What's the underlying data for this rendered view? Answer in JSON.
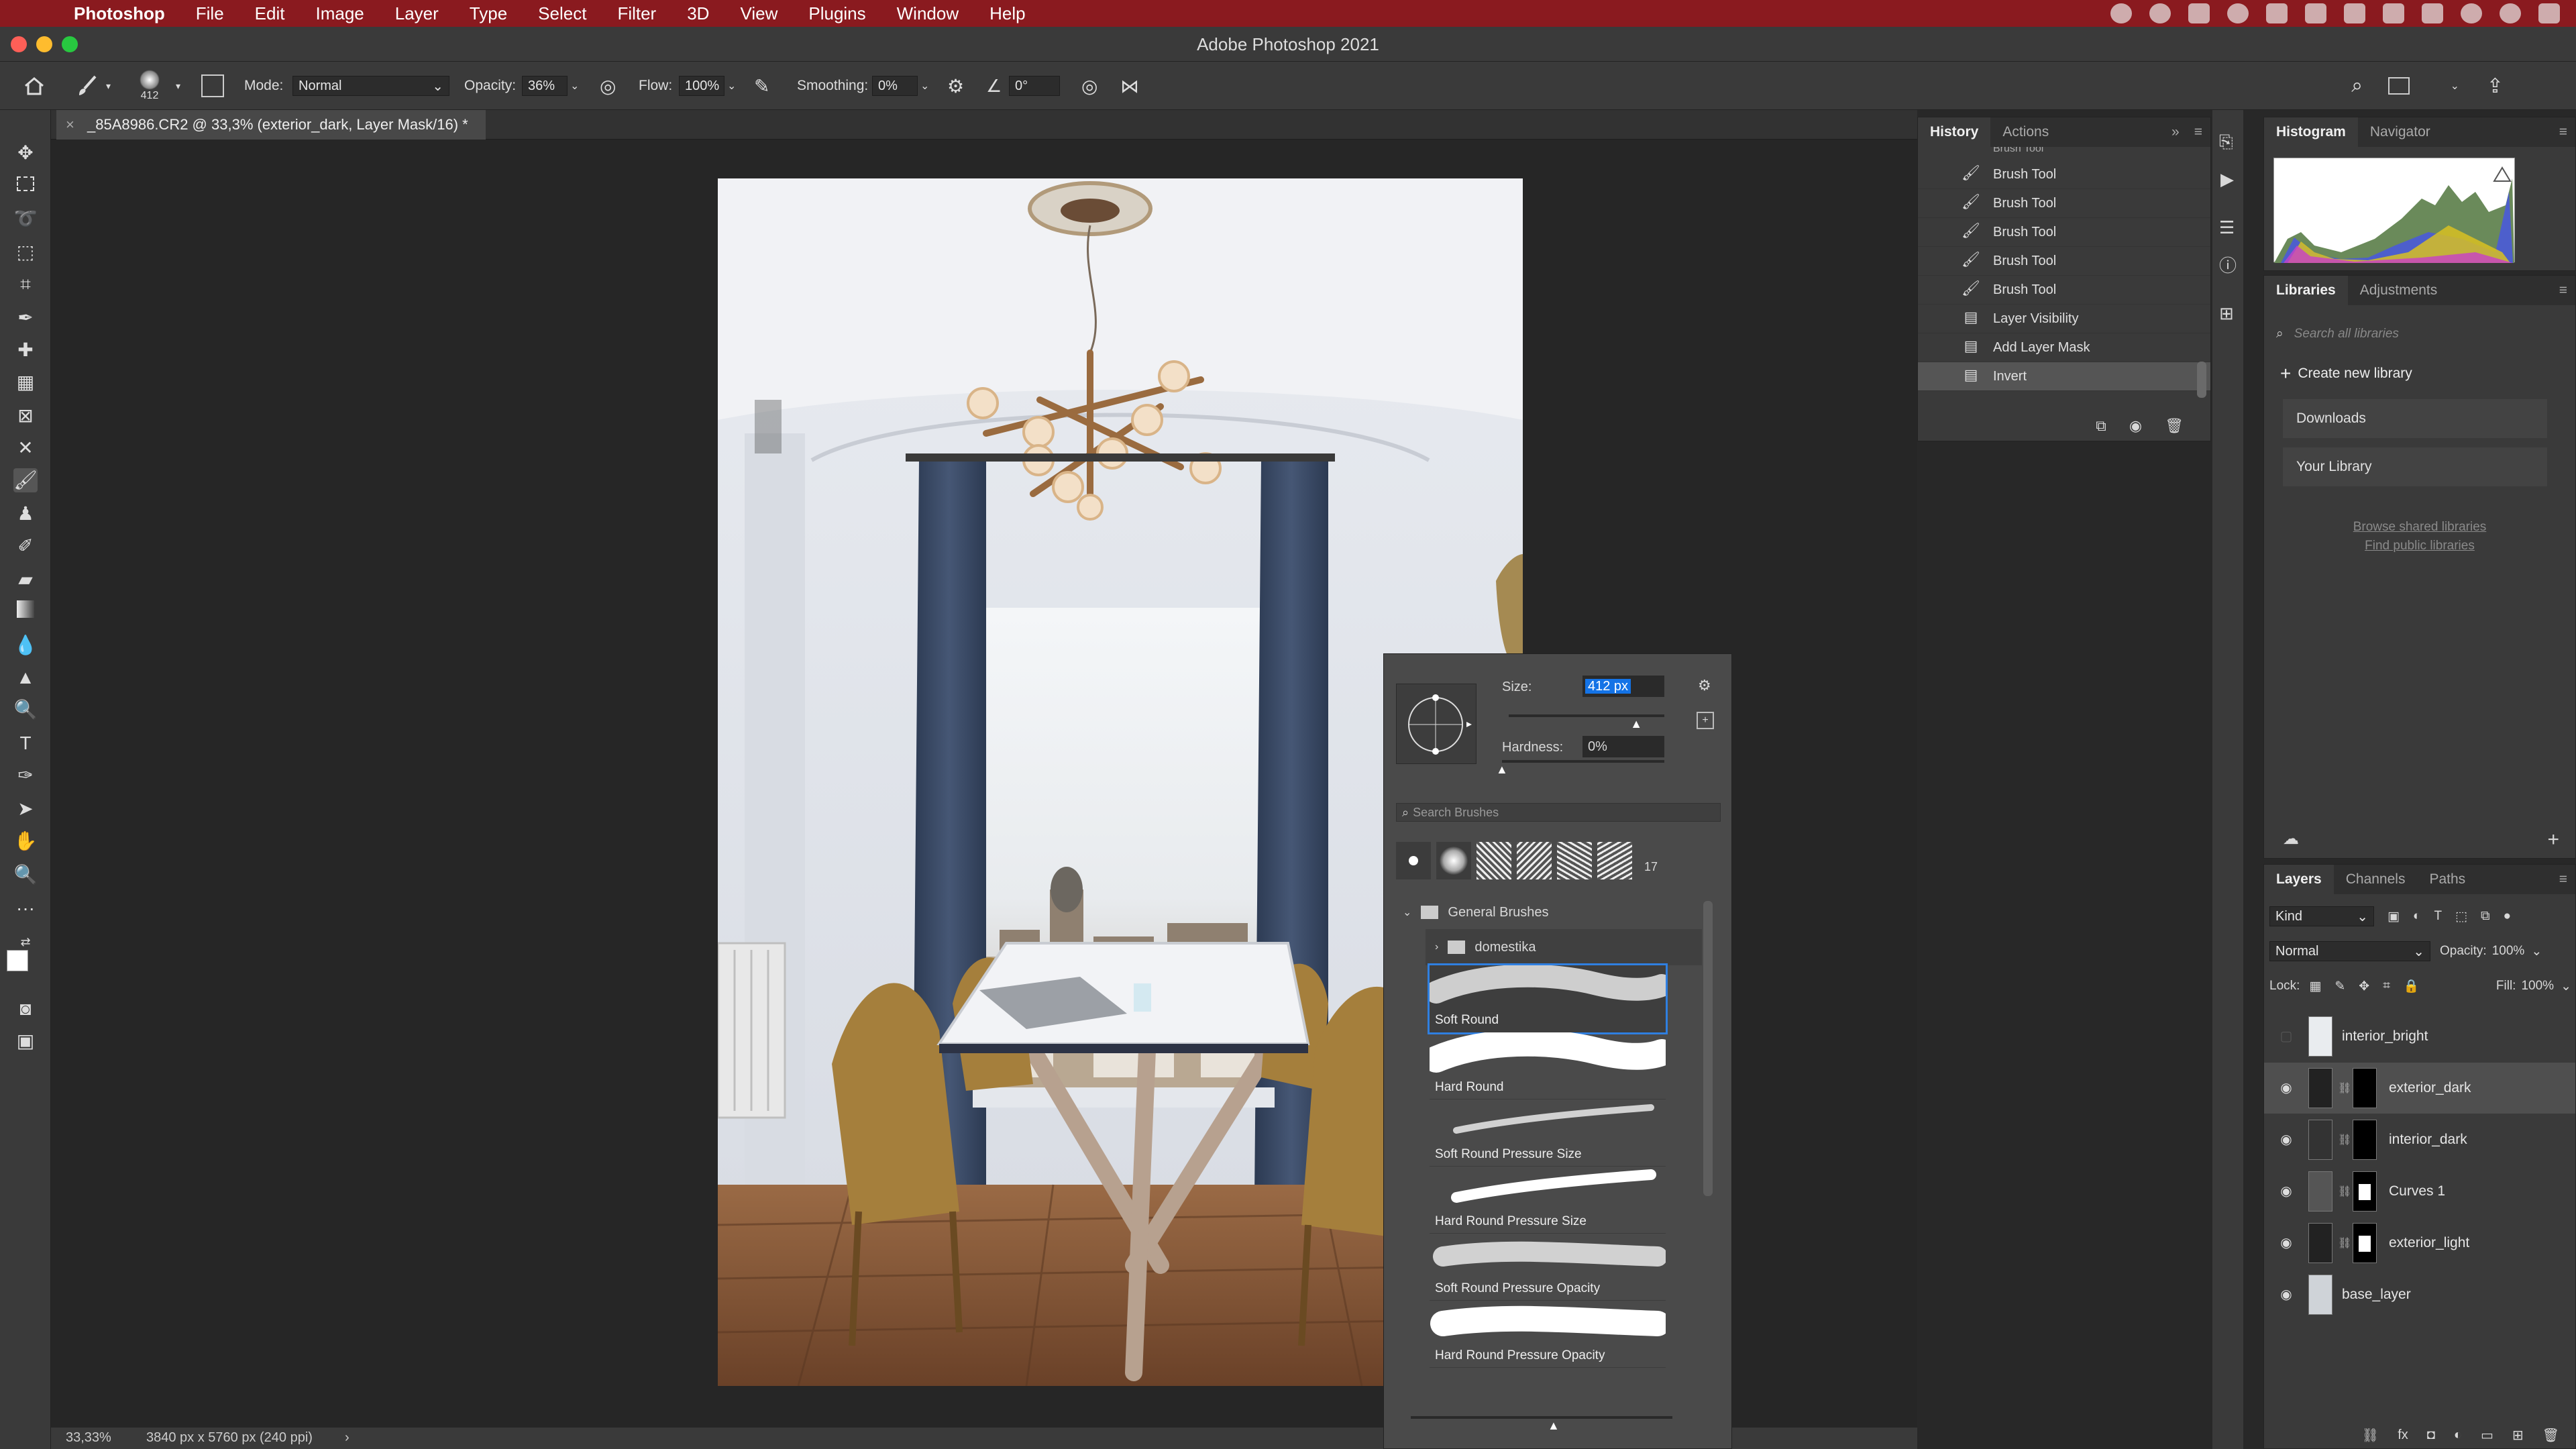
{
  "menubar": {
    "app": "Photoshop",
    "items": [
      "File",
      "Edit",
      "Image",
      "Layer",
      "Type",
      "Select",
      "Filter",
      "3D",
      "View",
      "Plugins",
      "Window",
      "Help"
    ]
  },
  "window": {
    "title": "Adobe Photoshop 2021"
  },
  "options": {
    "brush_size": "412",
    "mode_label": "Mode:",
    "mode_value": "Normal",
    "opacity_label": "Opacity:",
    "opacity_value": "36%",
    "flow_label": "Flow:",
    "flow_value": "100%",
    "smoothing_label": "Smoothing:",
    "smoothing_value": "0%",
    "angle_value": "0°"
  },
  "document": {
    "tab_title": "_85A8986.CR2 @ 33,3% (exterior_dark, Layer Mask/16) *"
  },
  "status": {
    "zoom": "33,33%",
    "dimensions": "3840 px x 5760 px (240 ppi)"
  },
  "history": {
    "tabs": [
      "History",
      "Actions"
    ],
    "rows": [
      {
        "label": "Brush Tool",
        "icon": "brush-icon"
      },
      {
        "label": "Brush Tool",
        "icon": "brush-icon"
      },
      {
        "label": "Brush Tool",
        "icon": "brush-icon"
      },
      {
        "label": "Brush Tool",
        "icon": "brush-icon"
      },
      {
        "label": "Brush Tool",
        "icon": "brush-icon"
      },
      {
        "label": "Layer Visibility",
        "icon": "document-icon"
      },
      {
        "label": "Add Layer Mask",
        "icon": "document-icon"
      },
      {
        "label": "Invert",
        "icon": "document-icon"
      }
    ],
    "partial_row": "Brush Tool"
  },
  "brush_picker": {
    "size_label": "Size:",
    "size_value": "412 px",
    "hardness_label": "Hardness:",
    "hardness_value": "0%",
    "search_placeholder": "Search Brushes",
    "recent_count": "17",
    "group": "General Brushes",
    "folder": "domestika",
    "brushes": [
      {
        "name": "Soft Round",
        "selected": true
      },
      {
        "name": "Hard Round",
        "selected": false
      },
      {
        "name": "Soft Round Pressure Size",
        "selected": false
      },
      {
        "name": "Hard Round Pressure Size",
        "selected": false
      },
      {
        "name": "Soft Round Pressure Opacity",
        "selected": false
      },
      {
        "name": "Hard Round Pressure Opacity",
        "selected": false
      }
    ],
    "size_fraction": 0.82,
    "hardness_fraction": 0.0
  },
  "histogram": {
    "tabs": [
      "Histogram",
      "Navigator"
    ]
  },
  "libraries": {
    "tabs": [
      "Libraries",
      "Adjustments"
    ],
    "search_placeholder": "Search all libraries",
    "create_label": "Create new library",
    "items": [
      "Downloads",
      "Your Library"
    ],
    "link_browse": "Browse shared libraries",
    "link_find": "Find public libraries"
  },
  "layers": {
    "tabs": [
      "Layers",
      "Channels",
      "Paths"
    ],
    "kind_label": "Kind",
    "blend_mode": "Normal",
    "opacity_label": "Opacity:",
    "opacity_value": "100%",
    "lock_label": "Lock:",
    "fill_label": "Fill:",
    "fill_value": "100%",
    "items": [
      {
        "name": "interior_bright",
        "visible": false,
        "selected": false
      },
      {
        "name": "exterior_dark",
        "visible": true,
        "selected": true
      },
      {
        "name": "interior_dark",
        "visible": true,
        "selected": false
      },
      {
        "name": "Curves 1",
        "visible": true,
        "selected": false
      },
      {
        "name": "exterior_light",
        "visible": true,
        "selected": false
      },
      {
        "name": "base_layer",
        "visible": true,
        "selected": false
      }
    ]
  },
  "colors": {
    "menubar": "#8a1a1f",
    "panel": "#3a3a3a",
    "canvas": "#262626",
    "accent": "#1473e6"
  }
}
